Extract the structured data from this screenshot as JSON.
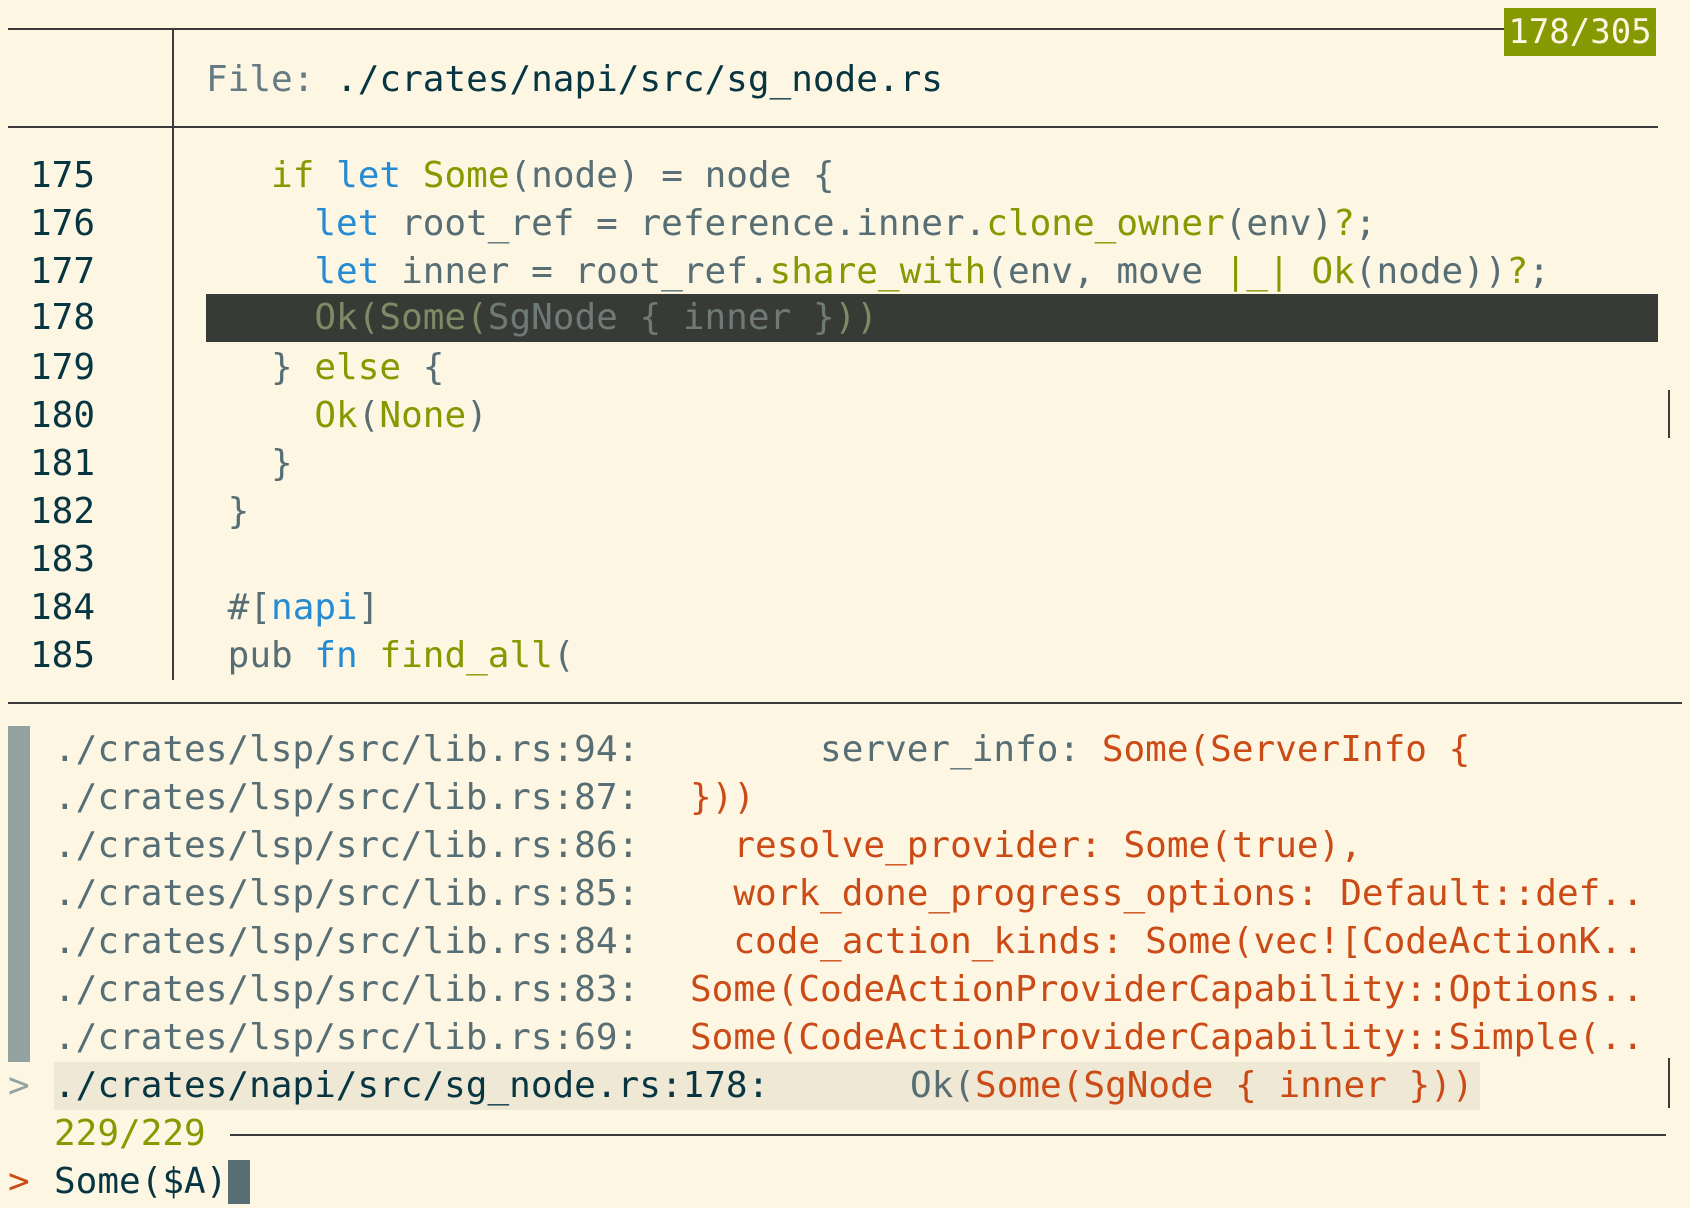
{
  "preview": {
    "position_counter": "178/305",
    "file_prefix": "File: ",
    "file_path": "./crates/napi/src/sg_node.rs",
    "lines": [
      {
        "no": "175"
      },
      {
        "no": "176"
      },
      {
        "no": "177"
      },
      {
        "no": "178"
      },
      {
        "no": "179"
      },
      {
        "no": "180"
      },
      {
        "no": "181"
      },
      {
        "no": "182"
      },
      {
        "no": "183"
      },
      {
        "no": "184"
      },
      {
        "no": "185"
      }
    ]
  },
  "results": [
    {
      "path": "./crates/lsp/src/lib.rs:94:",
      "pre": "      server_info: ",
      "snippet": "Some(ServerInfo {"
    },
    {
      "path": "./crates/lsp/src/lib.rs:87:",
      "pre": "",
      "snippet": "}))"
    },
    {
      "path": "./crates/lsp/src/lib.rs:86:",
      "pre": "",
      "snippet": "  resolve_provider: Some(true),"
    },
    {
      "path": "./crates/lsp/src/lib.rs:85:",
      "pre": "",
      "snippet": "  work_done_progress_options: Default::def.."
    },
    {
      "path": "./crates/lsp/src/lib.rs:84:",
      "pre": "",
      "snippet": "  code_action_kinds: Some(vec![CodeActionK.."
    },
    {
      "path": "./crates/lsp/src/lib.rs:83:",
      "pre": "",
      "snippet": "Some(CodeActionProviderCapability::Options.."
    },
    {
      "path": "./crates/lsp/src/lib.rs:69:",
      "pre": "",
      "snippet": "Some(CodeActionProviderCapability::Simple(.."
    }
  ],
  "selected": {
    "marker": ">",
    "path": "./crates/napi/src/sg_node.rs:178:",
    "pre": "Ok(",
    "snippet": "Some(SgNode { inner }))"
  },
  "status": {
    "match_count": "229/229"
  },
  "prompt": {
    "marker": ">",
    "query": "Some($A)"
  },
  "colors": {
    "background": "#fdf6e3",
    "badge": "#859900",
    "match": "#cb4b16",
    "highlight_row": "#383a36"
  }
}
